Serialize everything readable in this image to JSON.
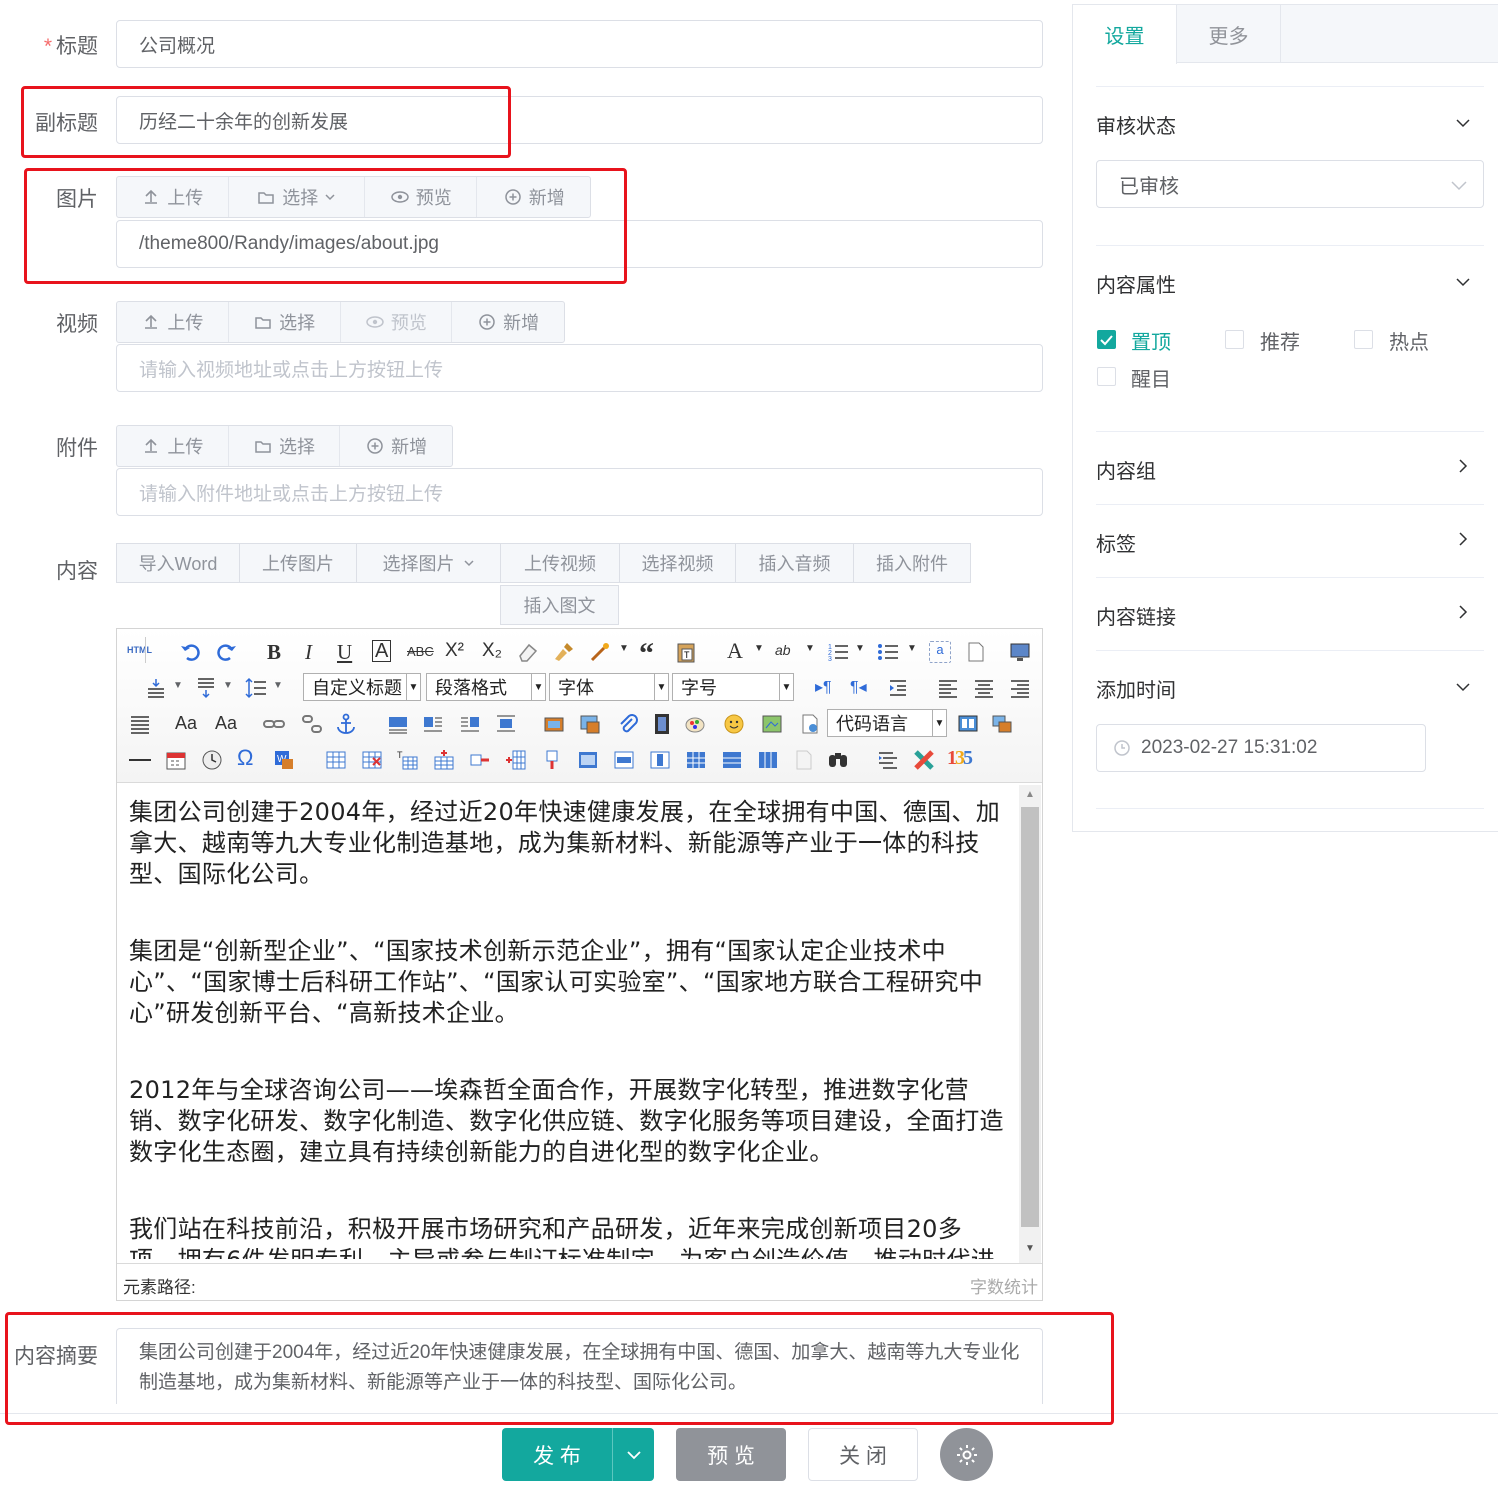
{
  "form": {
    "title": {
      "label": "标题",
      "value": "公司概况"
    },
    "subtitle": {
      "label": "副标题",
      "value": "历经二十余年的创新发展"
    },
    "image": {
      "label": "图片",
      "value": "/theme800/Randy/images/about.jpg",
      "buttons": [
        "上传",
        "选择",
        "预览",
        "新增"
      ]
    },
    "video": {
      "label": "视频",
      "placeholder": "请输入视频地址或点击上方按钮上传",
      "buttons": [
        "上传",
        "选择",
        "预览",
        "新增"
      ]
    },
    "attachment": {
      "label": "附件",
      "placeholder": "请输入附件地址或点击上方按钮上传",
      "buttons": [
        "上传",
        "选择",
        "新增"
      ]
    },
    "content": {
      "label": "内容",
      "buttons": [
        "导入Word",
        "上传图片",
        "选择图片",
        "上传视频",
        "选择视频",
        "插入音频",
        "插入附件",
        "插入图文"
      ]
    },
    "summary": {
      "label": "内容摘要",
      "value": "集团公司创建于2004年，经过近20年快速健康发展，在全球拥有中国、德国、加拿大、越南等九大专业化制造基地，成为集新材料、新能源等产业于一体的科技型、国际化公司。"
    }
  },
  "editor": {
    "selects": {
      "custom_heading": "自定义标题",
      "paragraph": "段落格式",
      "font": "字体",
      "font_size": "字号",
      "code_lang": "代码语言"
    },
    "html_btn": "HTML",
    "paragraphs": [
      "集团公司创建于2004年，经过近20年快速健康发展，在全球拥有中国、德国、加拿大、越南等九大专业化制造基地，成为集新材料、新能源等产业于一体的科技型、国际化公司。",
      "集团是“创新型企业”、“国家技术创新示范企业”，拥有“国家认定企业技术中心”、“国家博士后科研工作站”、“国家认可实验室”、“国家地方联合工程研究中心”研发创新平台、“高新技术企业。",
      "2012年与全球咨询公司——埃森哲全面合作，开展数字化转型，推进数字化营销、数字化研发、数字化制造、数字化供应链、数字化服务等项目建设，全面打造数字化生态圈，建立具有持续创新能力的自进化型的数字化企业。",
      "我们站在科技前沿，积极开展市场研究和产品研发，近年来完成创新项目20多项，拥有6件发明专利，主导或参与制订标准制定，为客户创造价值，推动时代进步。"
    ],
    "path_label": "元素路径:",
    "word_count": "字数统计"
  },
  "right_panel": {
    "tabs": [
      "设置",
      "更多"
    ],
    "review": {
      "title": "审核状态",
      "value": "已审核"
    },
    "attrs": {
      "title": "内容属性",
      "items": [
        {
          "label": "置顶",
          "checked": true
        },
        {
          "label": "推荐",
          "checked": false
        },
        {
          "label": "热点",
          "checked": false
        },
        {
          "label": "醒目",
          "checked": false
        }
      ]
    },
    "group": "内容组",
    "tags": "标签",
    "link": "内容链接",
    "time": {
      "title": "添加时间",
      "value": "2023-02-27 15:31:02"
    }
  },
  "footer": {
    "publish": "发 布",
    "preview": "预 览",
    "close": "关 闭"
  },
  "colors": {
    "accent": "#13a89e",
    "highlight": "#e8131c",
    "preview_btn": "#909399"
  }
}
